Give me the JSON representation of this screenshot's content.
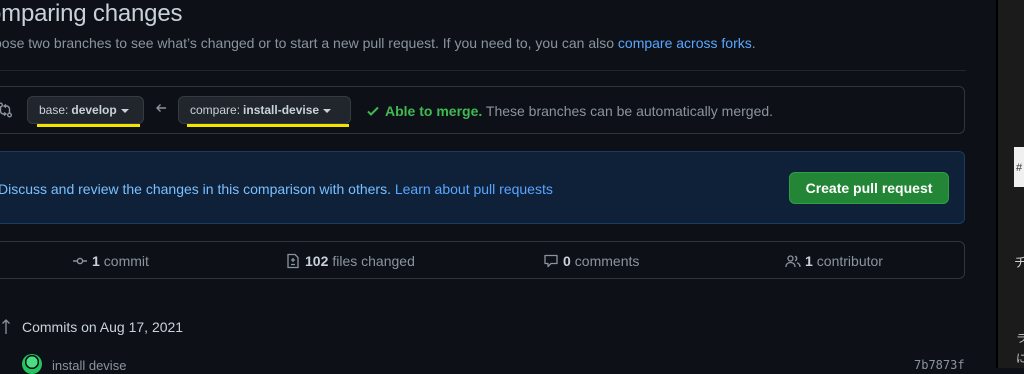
{
  "header": {
    "title": "omparing changes",
    "subtitle": "oose two branches to see what’s changed or to start a new pull request. If you need to, you can also ",
    "subtitle_link": "compare across forks",
    "subtitle_end": "."
  },
  "range": {
    "base_prefix": "base:",
    "base_branch": "develop",
    "compare_prefix": "compare:",
    "compare_branch": "install-devise",
    "merge_ok": "Able to merge.",
    "merge_text": " These branches can be automatically merged.",
    "highlight_color": "#f5e400"
  },
  "flash": {
    "text": "Discuss and review the changes in this comparison with others. ",
    "link": "Learn about pull requests",
    "button": "Create pull request"
  },
  "stats": {
    "commits_count": "1",
    "commits_label": "commit",
    "files_count": "102",
    "files_label": "files changed",
    "comments_count": "0",
    "comments_label": "comments",
    "contributors_count": "1",
    "contributors_label": "contributor"
  },
  "commits": {
    "heading": "Commits on Aug 17, 2021",
    "message": "install devise",
    "sha": "7b7873f"
  },
  "side_panel": {
    "items": [
      "#",
      "チ",
      "ラ",
      "に"
    ]
  }
}
